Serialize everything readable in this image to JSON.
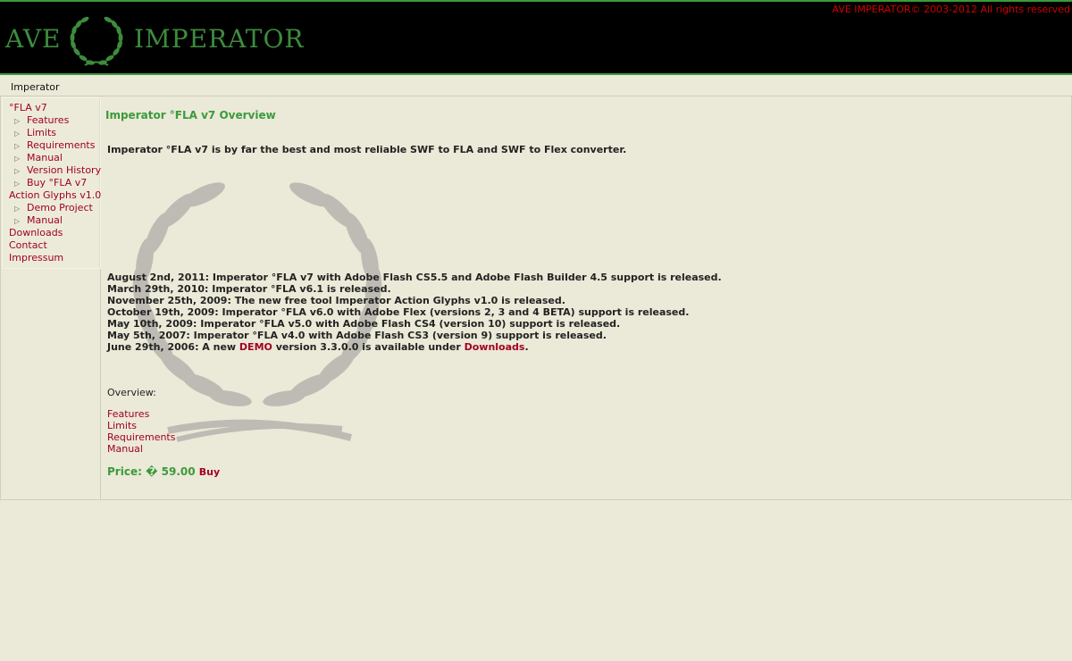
{
  "header": {
    "copyright": "AVE IMPERATOR© 2003-2012 All rights reserved",
    "logo_left": "AVE",
    "logo_right": "IMPERATOR"
  },
  "breadcrumb": "Imperator",
  "sidebar": {
    "items": [
      {
        "label": "°FLA v7",
        "level": 0
      },
      {
        "label": "Features",
        "level": 1
      },
      {
        "label": "Limits",
        "level": 1
      },
      {
        "label": "Requirements",
        "level": 1
      },
      {
        "label": "Manual",
        "level": 1
      },
      {
        "label": "Version History",
        "level": 1
      },
      {
        "label": "Buy °FLA v7",
        "level": 1
      },
      {
        "label": "Action Glyphs v1.0",
        "level": 0
      },
      {
        "label": "Demo Project",
        "level": 1
      },
      {
        "label": "Manual",
        "level": 1
      },
      {
        "label": "Downloads",
        "level": 0
      },
      {
        "label": "Contact",
        "level": 0
      },
      {
        "label": "Impressum",
        "level": 0
      }
    ]
  },
  "main": {
    "title": "Imperator °FLA v7 Overview",
    "intro": "Imperator °FLA v7 is by far the best and most reliable SWF to FLA and SWF to Flex converter.",
    "news": [
      "August 2nd, 2011: Imperator °FLA v7 with Adobe Flash CS5.5 and Adobe Flash Builder 4.5 support is released.",
      "March 29th, 2010: Imperator °FLA v6.1 is released.",
      "November 25th, 2009: The new free tool Imperator Action Glyphs v1.0 is released.",
      "October 19th, 2009: Imperator °FLA v6.0 with Adobe Flex (versions 2, 3 and 4 BETA) support is released.",
      "May 10th, 2009: Imperator °FLA v5.0 with Adobe Flash CS4 (version 10) support is released.",
      "May 5th, 2007: Imperator °FLA v4.0 with Adobe Flash CS3 (version 9) support is released."
    ],
    "news_last": {
      "prefix": "June 29th, 2006: A new ",
      "demo_link": "DEMO",
      "middle": " version 3.3.0.0 is available under ",
      "downloads_link": "Downloads",
      "suffix": "."
    },
    "overview_label": "Overview:",
    "overview_links": [
      "Features",
      "Limits",
      "Requirements",
      "Manual"
    ],
    "price_label": "Price:",
    "price_value": "� 59.00",
    "buy_label": "Buy"
  },
  "colors": {
    "background": "#ebe9d7",
    "header_bg": "#000000",
    "accent_green": "#3b9a3b",
    "link_red": "#a10022",
    "copyright_red": "#d00000"
  }
}
